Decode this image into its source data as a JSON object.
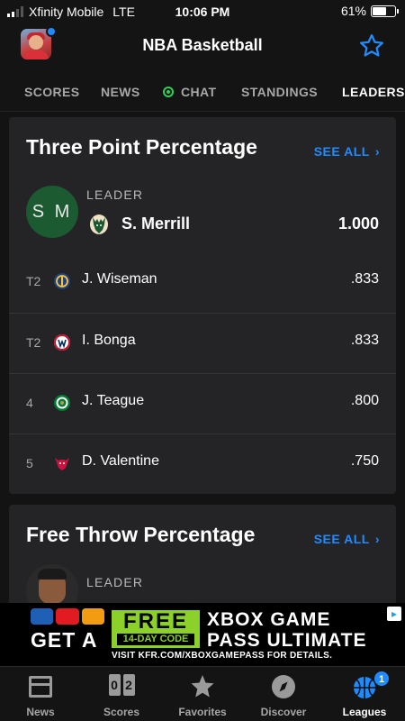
{
  "status_bar": {
    "carrier": "Xfinity Mobile",
    "network": "LTE",
    "time": "10:06 PM",
    "battery": "61%",
    "battery_level": 0.61
  },
  "header": {
    "title": "NBA Basketball"
  },
  "tabs": [
    {
      "label": "SCORES"
    },
    {
      "label": "NEWS"
    },
    {
      "label": "CHAT"
    },
    {
      "label": "STANDINGS"
    },
    {
      "label": "LEADERS",
      "active": true
    }
  ],
  "three_point": {
    "title": "Three Point Percentage",
    "see_all": "SEE ALL",
    "leader": {
      "label": "LEADER",
      "initials": "S M",
      "name": "S. Merrill",
      "value": "1.000",
      "team_icon": "bucks-logo-icon"
    },
    "rows": [
      {
        "rank": "T2",
        "name": "J. Wiseman",
        "value": ".833",
        "team_icon": "warriors-logo-icon"
      },
      {
        "rank": "T2",
        "name": "I. Bonga",
        "value": ".833",
        "team_icon": "wizards-logo-icon"
      },
      {
        "rank": "4",
        "name": "J. Teague",
        "value": ".800",
        "team_icon": "celtics-logo-icon"
      },
      {
        "rank": "5",
        "name": "D. Valentine",
        "value": ".750",
        "team_icon": "bulls-logo-icon"
      }
    ]
  },
  "free_throw": {
    "title": "Free Throw Percentage",
    "see_all": "SEE ALL",
    "leader_label": "LEADER"
  },
  "ad": {
    "get_a": "GET A",
    "free": "FREE",
    "code": "14-DAY CODE",
    "line1": "XBOX GAME",
    "line2": "PASS ULTIMATE",
    "visit": "VISIT KFR.COM/XBOXGAMEPASS FOR DETAILS."
  },
  "bottom_nav": [
    {
      "label": "News",
      "icon": "newspaper-icon"
    },
    {
      "label": "Scores",
      "icon": "scoreboard-icon",
      "digits": [
        "0",
        "2"
      ]
    },
    {
      "label": "Favorites",
      "icon": "star-icon"
    },
    {
      "label": "Discover",
      "icon": "compass-icon"
    },
    {
      "label": "Leagues",
      "icon": "basketball-icon",
      "badge": "1",
      "active": true
    }
  ],
  "colors": {
    "accent": "#1f8bff",
    "background": "#131313",
    "card": "#242426",
    "chat_green": "#2bd056",
    "leader_circle": "#1c5a31"
  }
}
